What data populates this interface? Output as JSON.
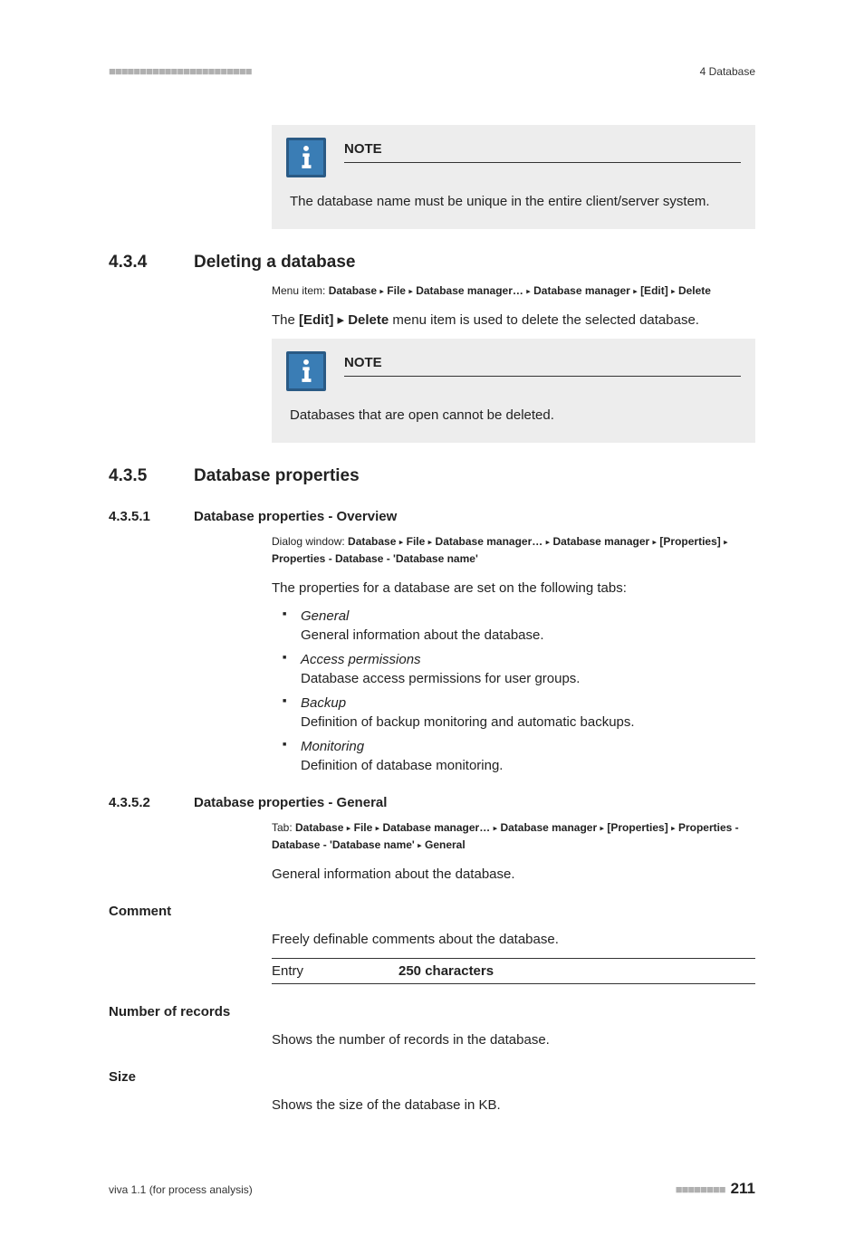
{
  "header": {
    "dashes": "■■■■■■■■■■■■■■■■■■■■■■■",
    "right": "4 Database"
  },
  "note1": {
    "heading": "NOTE",
    "text": "The database name must be unique in the entire client/server system."
  },
  "sec434": {
    "num": "4.3.4",
    "title": "Deleting a database",
    "crumb_label": "Menu item: ",
    "crumb_parts": [
      "Database",
      "File",
      "Database manager…",
      "Database manager",
      "[Edit]",
      "Delete"
    ],
    "body_pre": "The ",
    "body_edit": "[Edit]",
    "body_sep": " ▸ ",
    "body_del": "Delete",
    "body_post": " menu item is used to delete the selected database."
  },
  "note2": {
    "heading": "NOTE",
    "text": "Databases that are open cannot be deleted."
  },
  "sec435": {
    "num": "4.3.5",
    "title": "Database properties"
  },
  "sec4351": {
    "num": "4.3.5.1",
    "title": "Database properties - Overview",
    "crumb_label": "Dialog window: ",
    "crumb_parts": [
      "Database",
      "File",
      "Database manager…",
      "Database manager",
      "[Properties]",
      "Properties - Database - 'Database name'"
    ],
    "intro": "The properties for a database are set on the following tabs:",
    "tabs": [
      {
        "label": "General",
        "desc": "General information about the database."
      },
      {
        "label": "Access permissions",
        "desc": "Database access permissions for user groups."
      },
      {
        "label": "Backup",
        "desc": "Definition of backup monitoring and automatic backups."
      },
      {
        "label": "Monitoring",
        "desc": "Definition of database monitoring."
      }
    ]
  },
  "sec4352": {
    "num": "4.3.5.2",
    "title": "Database properties - General",
    "crumb_label": "Tab: ",
    "crumb_parts": [
      "Database",
      "File",
      "Database manager…",
      "Database manager",
      "[Properties]",
      "Properties - Database - 'Database name'",
      "General"
    ],
    "intro": "General information about the database.",
    "comment": {
      "label": "Comment",
      "desc": "Freely definable comments about the database.",
      "entry_label": "Entry",
      "entry_value": "250 characters"
    },
    "numrec": {
      "label": "Number of records",
      "desc": "Shows the number of records in the database."
    },
    "size": {
      "label": "Size",
      "desc": "Shows the size of the database in KB."
    }
  },
  "footer": {
    "left": "viva 1.1 (for process analysis)",
    "dashes": "■■■■■■■■",
    "page": "211"
  },
  "glyphs": {
    "tri": "▸"
  }
}
